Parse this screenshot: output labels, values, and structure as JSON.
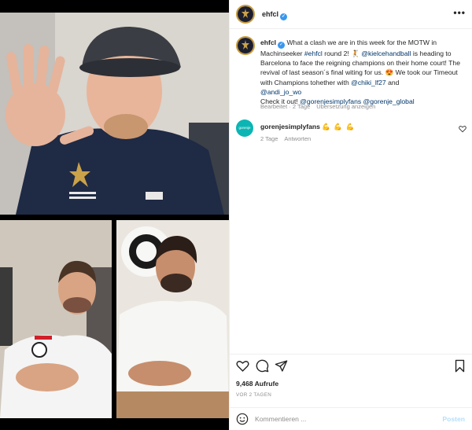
{
  "post": {
    "username": "ehfcl",
    "more_label": "•••"
  },
  "caption": {
    "username": "ehfcl",
    "text_1": " What a clash we are in this week for the MOTW in Machinseeker ",
    "hashtag": "#ehfcl",
    "text_2": " round 2! 🤾 ",
    "mention_1": "@kielcehandball",
    "text_3": " is heading to Barcelona to face the reigning champions on their home court! The revival of last season´s final witing for us. 😍 We took our Timeout with Champions tohether with ",
    "mention_2": "@chiki_lf27",
    "text_4": " and ",
    "mention_3": "@andi_jo_wo",
    "text_5": "Check it out! ",
    "mention_4": "@gorenjesimplyfans",
    "mention_5": "@gorenje_global",
    "edited": "Bearbeitet · 2 Tage",
    "translate": "Übersetzung anzeigen"
  },
  "comment": {
    "avatar_text": "gorenje",
    "username": "gorenjesimplyfans",
    "text": "💪 💪 💪",
    "time": "2 Tage",
    "reply": "Antworten"
  },
  "stats": {
    "views": "9,468 Aufrufe",
    "ago": "VOR 2 TAGEN"
  },
  "composer": {
    "placeholder": "Kommentieren ...",
    "post_label": "Posten"
  },
  "colors": {
    "accent_link": "#00376b",
    "verified": "#3897f0",
    "post_button": "#b2dffc"
  }
}
